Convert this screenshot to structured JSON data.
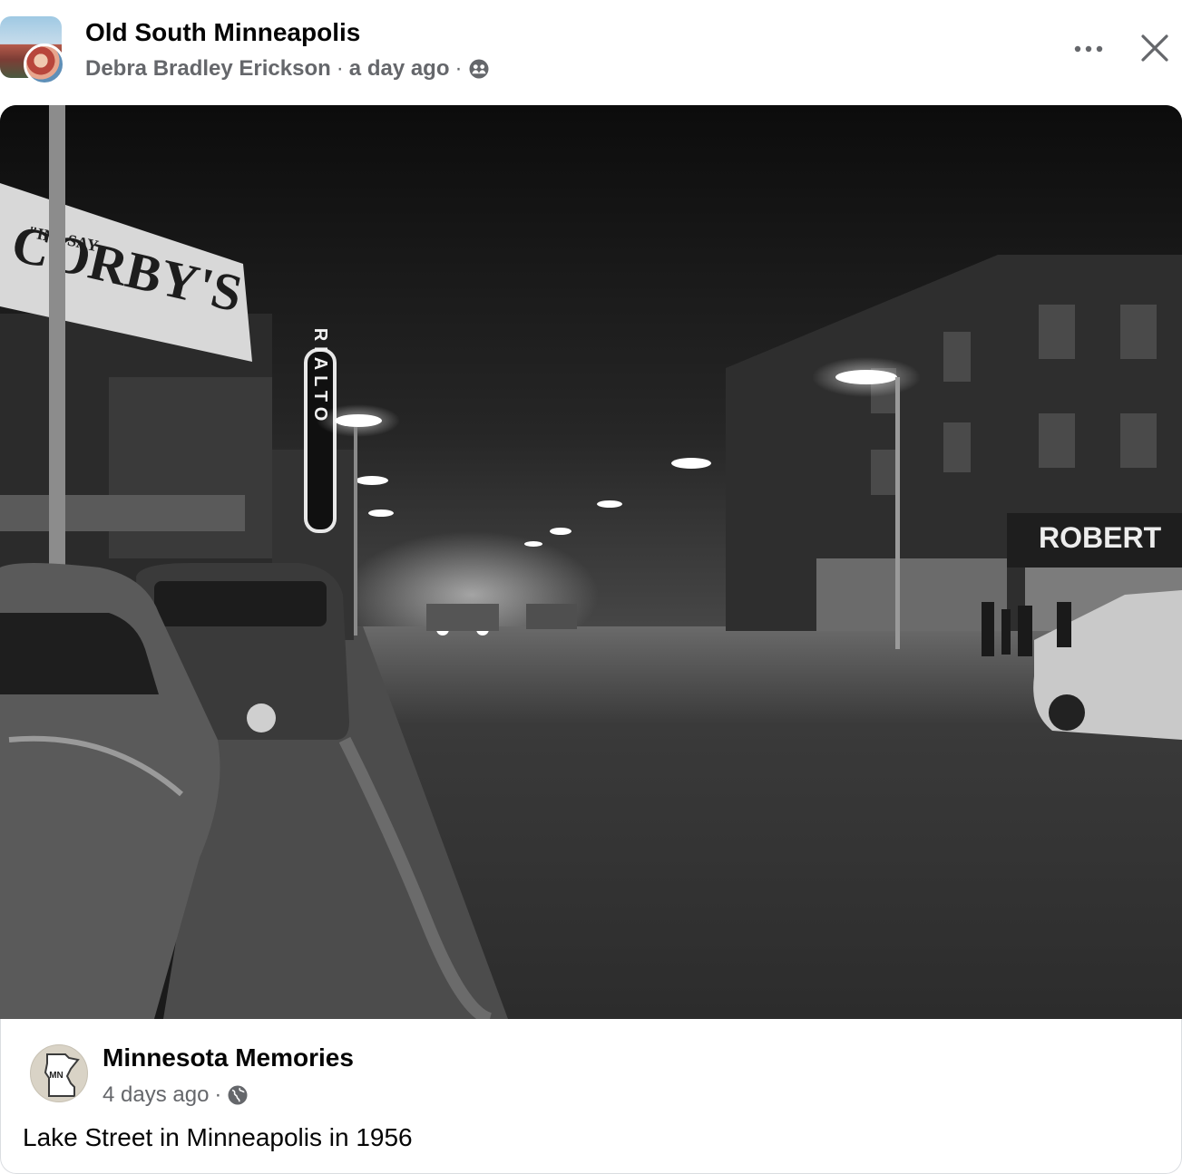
{
  "header": {
    "group_name": "Old South Minneapolis",
    "author": "Debra Bradley Erickson",
    "separator": "·",
    "time": "a day ago",
    "privacy_icon": "group-members-icon",
    "more_icon": "more-dots-icon",
    "close_icon": "close-icon"
  },
  "photo": {
    "signs": {
      "billboard_top": "\"IN\" SAY",
      "billboard": "CORBY'S",
      "theater": "RIALTO",
      "store": "ROBERT"
    }
  },
  "shared": {
    "page_name": "Minnesota Memories",
    "page_avatar_label": "MN",
    "time": "4 days ago",
    "separator": "·",
    "audience_icon": "globe-icon",
    "caption": "Lake Street in Minneapolis in 1956"
  }
}
